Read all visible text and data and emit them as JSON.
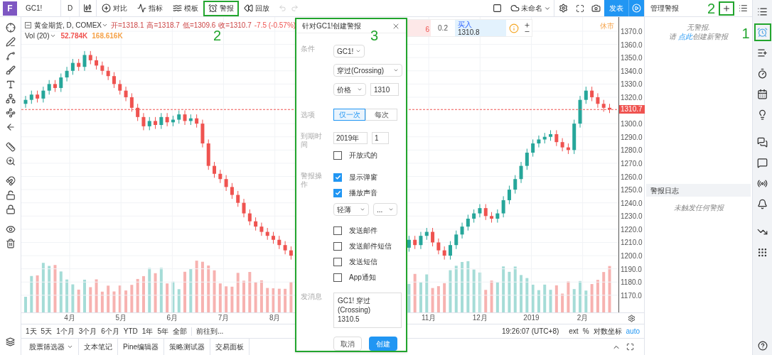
{
  "top_toolbar": {
    "logo": "F",
    "symbol": "GC1!",
    "interval": "D",
    "buttons": [
      {
        "kind": "compare",
        "label": "对比",
        "highlight": false
      },
      {
        "kind": "indicators",
        "label": "指标",
        "highlight": false
      },
      {
        "kind": "templates",
        "label": "模板",
        "highlight": false
      },
      {
        "kind": "alert",
        "label": "警报",
        "highlight": true,
        "callout": "2"
      },
      {
        "kind": "replay",
        "label": "回放",
        "highlight": false
      }
    ],
    "layout_name": "未命名",
    "publish": "发表"
  },
  "legend": {
    "title": "黄金期货, D, COMEX",
    "ohlc": [
      "开=1318.1",
      "高=1318.7",
      "低=1309.6",
      "收=1310.7"
    ],
    "change": "-7.5 (-0.57%)"
  },
  "volume": {
    "label": "Vol (20)",
    "values": [
      {
        "text": "52.784K",
        "color": "#ef5350"
      },
      {
        "text": "168.616K",
        "color": "#f5a34a"
      }
    ]
  },
  "trade": {
    "sell": "6",
    "spread": "0.2",
    "buy_label": "买入",
    "buy_price": "1310.8"
  },
  "market_status": "休市",
  "chart": {
    "last_price": "1310.7",
    "time_axis": [
      "2019",
      "2月"
    ],
    "chart_data": {
      "type": "candlestick",
      "xlim": [
        3.057,
        15.197
      ],
      "ylim": [
        1157,
        1380.75
      ],
      "grid": true,
      "ref_lines": [
        {
          "axis": "y",
          "value": 1310.7,
          "color": "#ef5350"
        }
      ],
      "xticks": [
        {
          "value": 4,
          "label": "4月"
        },
        {
          "value": 5,
          "label": "5月"
        },
        {
          "value": 6,
          "label": "6月"
        },
        {
          "value": 7,
          "label": "7月"
        },
        {
          "value": 8,
          "label": "8月"
        },
        {
          "value": 11,
          "label": "11月"
        },
        {
          "value": 12,
          "label": "12月"
        }
      ],
      "yticks": [
        {
          "value": 1370,
          "label": "1370.0"
        },
        {
          "value": 1360,
          "label": "1360.0"
        },
        {
          "value": 1350,
          "label": "1350.0"
        },
        {
          "value": 1340,
          "label": "1340.0"
        },
        {
          "value": 1330,
          "label": "1330.0"
        },
        {
          "value": 1320,
          "label": "1320.0"
        },
        {
          "value": 1300,
          "label": "1300.0"
        },
        {
          "value": 1290,
          "label": "1290.0"
        },
        {
          "value": 1280,
          "label": "1280.0"
        },
        {
          "value": 1270,
          "label": "1270.0"
        },
        {
          "value": 1260,
          "label": "1260.0"
        },
        {
          "value": 1250,
          "label": "1250.0"
        },
        {
          "value": 1240,
          "label": "1240.0"
        },
        {
          "value": 1230,
          "label": "1230.0"
        },
        {
          "value": 1220,
          "label": "1220.0"
        },
        {
          "value": 1210,
          "label": "1210.0"
        },
        {
          "value": 1200,
          "label": "1200.0"
        },
        {
          "value": 1190,
          "label": "1190.0"
        },
        {
          "value": 1180,
          "label": "1180.0"
        },
        {
          "value": 1170,
          "label": "1170.0"
        }
      ],
      "x": [
        3.14,
        3.255,
        3.37,
        3.485,
        3.6,
        3.715,
        3.83,
        3.945,
        4.06,
        4.175,
        4.29,
        4.405,
        4.52,
        4.635,
        4.75,
        4.865,
        4.98,
        5.095,
        5.21,
        5.325,
        5.44,
        5.555,
        5.67,
        5.785,
        5.9,
        6.015,
        6.13,
        6.245,
        6.36,
        6.475,
        6.59,
        6.705,
        6.82,
        6.935,
        7.05,
        7.165,
        7.28,
        7.395,
        7.51,
        7.625,
        7.74,
        7.855,
        7.97,
        8.085,
        8.2,
        8.315,
        10.615,
        10.73,
        10.845,
        10.96,
        11.075,
        11.19,
        11.305,
        11.42,
        11.535,
        11.65,
        11.765,
        11.88,
        11.995,
        12.11,
        12.225,
        12.34,
        12.455,
        12.57,
        12.685,
        12.8,
        12.915,
        13.03,
        13.145,
        13.26,
        13.375,
        13.49,
        13.605,
        13.72,
        13.835,
        13.95,
        14.065,
        14.18,
        14.295,
        14.41,
        14.525
      ],
      "ohlc": [
        [
          1315,
          1321,
          1312,
          1318
        ],
        [
          1318,
          1325,
          1315,
          1322
        ],
        [
          1322,
          1325,
          1316,
          1319
        ],
        [
          1319,
          1328,
          1316,
          1325
        ],
        [
          1325,
          1333,
          1322,
          1330
        ],
        [
          1330,
          1333,
          1324,
          1327
        ],
        [
          1327,
          1338,
          1324,
          1335
        ],
        [
          1335,
          1343,
          1332,
          1340
        ],
        [
          1340,
          1349,
          1337,
          1346
        ],
        [
          1346,
          1349,
          1340,
          1343
        ],
        [
          1343,
          1355,
          1340,
          1352
        ],
        [
          1352,
          1355,
          1345,
          1348
        ],
        [
          1348,
          1351,
          1341,
          1344
        ],
        [
          1344,
          1347,
          1337,
          1340
        ],
        [
          1340,
          1343,
          1333,
          1336
        ],
        [
          1336,
          1339,
          1327,
          1330
        ],
        [
          1330,
          1333,
          1322,
          1325
        ],
        [
          1325,
          1328,
          1317,
          1320
        ],
        [
          1320,
          1323,
          1309,
          1312
        ],
        [
          1312,
          1315,
          1302,
          1305
        ],
        [
          1305,
          1308,
          1295,
          1298
        ],
        [
          1298,
          1305,
          1295,
          1302
        ],
        [
          1302,
          1305,
          1296,
          1299
        ],
        [
          1299,
          1308,
          1296,
          1305
        ],
        [
          1305,
          1308,
          1298,
          1301
        ],
        [
          1301,
          1306,
          1298,
          1303
        ],
        [
          1303,
          1310,
          1300,
          1307
        ],
        [
          1307,
          1310,
          1299,
          1302
        ],
        [
          1302,
          1307,
          1299,
          1304
        ],
        [
          1304,
          1307,
          1297,
          1300
        ],
        [
          1300,
          1303,
          1282,
          1285
        ],
        [
          1285,
          1288,
          1265,
          1268
        ],
        [
          1268,
          1271,
          1259,
          1262
        ],
        [
          1262,
          1265,
          1255,
          1258
        ],
        [
          1258,
          1261,
          1249,
          1252
        ],
        [
          1252,
          1255,
          1243,
          1246
        ],
        [
          1246,
          1249,
          1237,
          1240
        ],
        [
          1240,
          1243,
          1229,
          1232
        ],
        [
          1232,
          1235,
          1223,
          1226
        ],
        [
          1226,
          1229,
          1219,
          1222
        ],
        [
          1222,
          1225,
          1215,
          1218
        ],
        [
          1218,
          1221,
          1212,
          1215
        ],
        [
          1215,
          1218,
          1209,
          1212
        ],
        [
          1212,
          1215,
          1205,
          1208
        ],
        [
          1208,
          1211,
          1201,
          1204
        ],
        [
          1204,
          1207,
          1197,
          1200
        ],
        [
          1206,
          1215,
          1203,
          1212
        ],
        [
          1212,
          1215,
          1205,
          1208
        ],
        [
          1208,
          1218,
          1205,
          1215
        ],
        [
          1215,
          1221,
          1212,
          1218
        ],
        [
          1218,
          1221,
          1207,
          1210
        ],
        [
          1210,
          1213,
          1201,
          1204
        ],
        [
          1204,
          1207,
          1197,
          1200
        ],
        [
          1200,
          1211,
          1197,
          1208
        ],
        [
          1208,
          1219,
          1205,
          1216
        ],
        [
          1216,
          1225,
          1213,
          1222
        ],
        [
          1222,
          1231,
          1219,
          1228
        ],
        [
          1228,
          1235,
          1225,
          1232
        ],
        [
          1232,
          1239,
          1229,
          1236
        ],
        [
          1236,
          1239,
          1227,
          1230
        ],
        [
          1230,
          1233,
          1225,
          1228
        ],
        [
          1228,
          1235,
          1225,
          1232
        ],
        [
          1232,
          1245,
          1229,
          1242
        ],
        [
          1242,
          1253,
          1239,
          1250
        ],
        [
          1250,
          1261,
          1247,
          1258
        ],
        [
          1258,
          1271,
          1255,
          1268
        ],
        [
          1268,
          1281,
          1265,
          1278
        ],
        [
          1278,
          1288,
          1275,
          1285
        ],
        [
          1285,
          1291,
          1282,
          1288
        ],
        [
          1288,
          1293,
          1285,
          1290
        ],
        [
          1290,
          1295,
          1287,
          1292
        ],
        [
          1292,
          1295,
          1283,
          1286
        ],
        [
          1286,
          1289,
          1279,
          1282
        ],
        [
          1282,
          1285,
          1277,
          1280
        ],
        [
          1280,
          1303,
          1277,
          1300
        ],
        [
          1300,
          1321,
          1297,
          1318
        ],
        [
          1318,
          1328,
          1315,
          1325
        ],
        [
          1325,
          1328,
          1317,
          1320
        ],
        [
          1320,
          1323,
          1312,
          1315
        ],
        [
          1315,
          1318,
          1309,
          1312
        ],
        [
          1312,
          1315,
          1308,
          1310.7
        ]
      ]
    }
  },
  "range_bar": {
    "ranges": [
      "1天",
      "5天",
      "1个月",
      "3个月",
      "6个月",
      "YTD",
      "1年",
      "5年",
      "全部"
    ],
    "goto": "前往到...",
    "time": "19:26:07 (UTC+8)",
    "options": [
      {
        "label": "ext",
        "selected": false
      },
      {
        "label": "%",
        "selected": false
      },
      {
        "label": "对数坐标",
        "selected": false
      },
      {
        "label": "auto",
        "selected": true
      }
    ]
  },
  "bottom_tabs": [
    {
      "label": "股票筛选器",
      "dropdown": true
    },
    {
      "label": "文本笔记",
      "dropdown": false
    },
    {
      "label": "Pine编辑器",
      "dropdown": false
    },
    {
      "label": "策略测试器",
      "dropdown": false
    },
    {
      "label": "交易面板",
      "dropdown": false
    }
  ],
  "dialog": {
    "title": "针对GC1!创建警报",
    "callout": "3",
    "highlight": true,
    "condition_label": "条件",
    "symbol": "GC1!",
    "operator": "穿过(Crossing)",
    "source": "价格",
    "value": "1310",
    "options_label": "选项",
    "frequency": [
      {
        "label": "仅一次",
        "selected": true
      },
      {
        "label": "每次",
        "selected": false
      }
    ],
    "expiry_label": "到期时间",
    "expiry_date": "2019年",
    "expiry_time": "1",
    "open_ended": {
      "label": "开放式的",
      "checked": false
    },
    "actions_label": "警报操作",
    "actions": [
      {
        "label": "显示弹窗",
        "checked": true
      },
      {
        "label": "播放声音",
        "checked": true,
        "sound": "轻薄",
        "duration": "..."
      },
      {
        "label": "发送邮件",
        "checked": false
      },
      {
        "label": "发送邮件短信",
        "checked": false
      },
      {
        "label": "发送短信",
        "checked": false
      },
      {
        "label": "App通知",
        "checked": false
      }
    ],
    "message_label": "发消息",
    "message": "GC1! 穿过(Crossing)\n1310.5",
    "cancel": "取消",
    "create": "创建"
  },
  "alerts_panel": {
    "title": "管理警报",
    "add_highlight": true,
    "add_callout": "2",
    "empty": "无警报.",
    "hint_before": "请 ",
    "hint_link": "点此",
    "hint_after": "创建新警报",
    "log_title": "警报日志",
    "log_empty": "未触发任何警报"
  },
  "right_bar": [
    {
      "kind": "object-tree",
      "selected": false
    },
    {
      "kind": "alerts",
      "selected": true,
      "highlight": true,
      "callout": "1"
    },
    {
      "kind": "watchlist",
      "selected": false
    },
    {
      "kind": "timer",
      "selected": false
    },
    {
      "kind": "calendar",
      "selected": false
    },
    {
      "kind": "ideas",
      "selected": false
    },
    {
      "kind": "chats",
      "selected": false
    },
    {
      "kind": "chat",
      "selected": false
    },
    {
      "kind": "streams",
      "selected": false
    },
    {
      "kind": "notifications",
      "selected": false
    },
    {
      "kind": "trends",
      "selected": false
    },
    {
      "kind": "data",
      "selected": false
    }
  ]
}
